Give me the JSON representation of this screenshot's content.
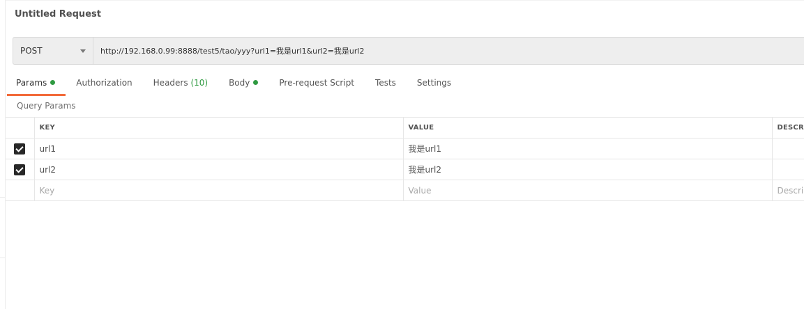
{
  "request": {
    "title": "Untitled Request",
    "method": "POST",
    "url": "http://192.168.0.99:8888/test5/tao/yyy?url1=我是url1&url2=我是url2"
  },
  "tabs": {
    "params": "Params",
    "authorization": "Authorization",
    "headers": "Headers",
    "headers_count": "(10)",
    "body": "Body",
    "pre_request": "Pre-request Script",
    "tests": "Tests",
    "settings": "Settings"
  },
  "query_params": {
    "title": "Query Params",
    "columns": {
      "key": "KEY",
      "value": "VALUE",
      "description": "DESCRIPTION"
    },
    "rows": [
      {
        "key": "url1",
        "value": "我是url1",
        "description": ""
      },
      {
        "key": "url2",
        "value": "我是url2",
        "description": ""
      }
    ],
    "placeholders": {
      "key": "Key",
      "value": "Value",
      "description": "Description"
    }
  },
  "colors": {
    "active_tab_underline": "#f26b3a",
    "indicator_green": "#2f9a41"
  }
}
